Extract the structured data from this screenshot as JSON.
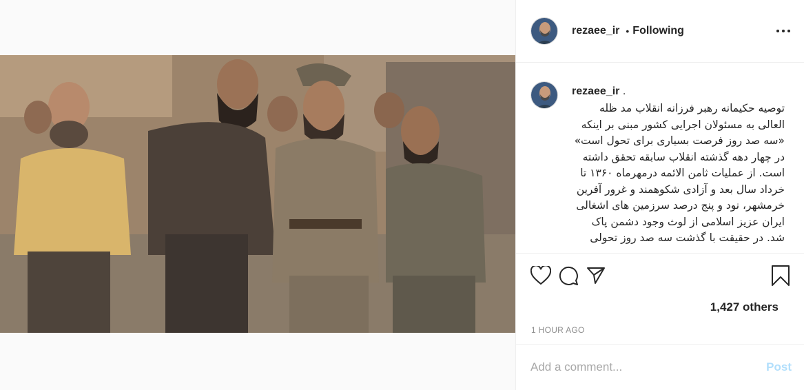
{
  "post": {
    "image_alt": "Group of men in military clothing walking together",
    "liked": false
  },
  "header": {
    "username": "rezaee_ir",
    "separator": "•",
    "follow_status": "Following"
  },
  "caption": {
    "username": "rezaee_ir",
    "suffix": ".",
    "text": "توصیه حکیمانه رهبر فرزانه انقلاب مد ظله العالی به مسئولان اجرایی کشور مبنی بر اینکه «سه صد روز فرصت بسیاری برای تحول است» در چهار دهه گذشته انقلاب سابقه تحقق داشته است. از عملیات ثامن الائمه درمهرماه ۱۳۶۰ تا خرداد سال بعد و آزادی شکوهمند و غرور آفرین خرمشهر، نود و پنج درصد سرزمین های اشغالی ایران عزیز اسلامی از لوث وجود دشمن پاک شد. در حقیقت با گذشت سه صد روز تحولی"
  },
  "actions": {
    "like_icon": "heart-icon",
    "comment_icon": "comment-icon",
    "share_icon": "share-icon",
    "save_icon": "bookmark-icon"
  },
  "likes": {
    "text": "1,427 others"
  },
  "timestamp": "1 HOUR AGO",
  "comment_box": {
    "placeholder": "Add a comment...",
    "post_label": "Post"
  },
  "colors": {
    "post_disabled": "#b2dffc",
    "muted": "#8e8e8e",
    "border": "#efefef"
  }
}
